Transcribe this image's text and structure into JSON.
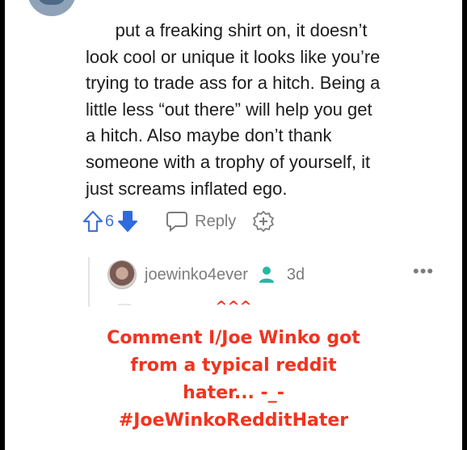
{
  "comment": {
    "lines": [
      "      put a freaking shirt on, it doesn’t",
      "look cool or unique it looks like you’re",
      "trying to trade ass for a hitch. Being a",
      "little less “out there” will help you get",
      "a hitch. Also maybe don’t thank",
      "someone with a trophy of yourself, it",
      "just screams inflated ego."
    ]
  },
  "actions": {
    "score": "6",
    "reply_label": "Reply",
    "icons": [
      "upvote-icon",
      "downvote-icon",
      "reply-bubble-icon",
      "award-icon"
    ]
  },
  "reply": {
    "username": "joewinko4ever",
    "age": "3d",
    "more": "•••",
    "icons": [
      "avatar",
      "user-icon",
      "more-options-icon"
    ]
  },
  "caption": {
    "carets": "^^^",
    "lines": [
      "Comment I/Joe Winko got",
      "from a typical reddit",
      "hater... -_-",
      "#JoeWinkoRedditHater"
    ]
  },
  "colors": {
    "upvote": "#4472d8",
    "downvote": "#2f6bdc",
    "caption": "#f2331f",
    "user_icon": "#26b8a5"
  }
}
